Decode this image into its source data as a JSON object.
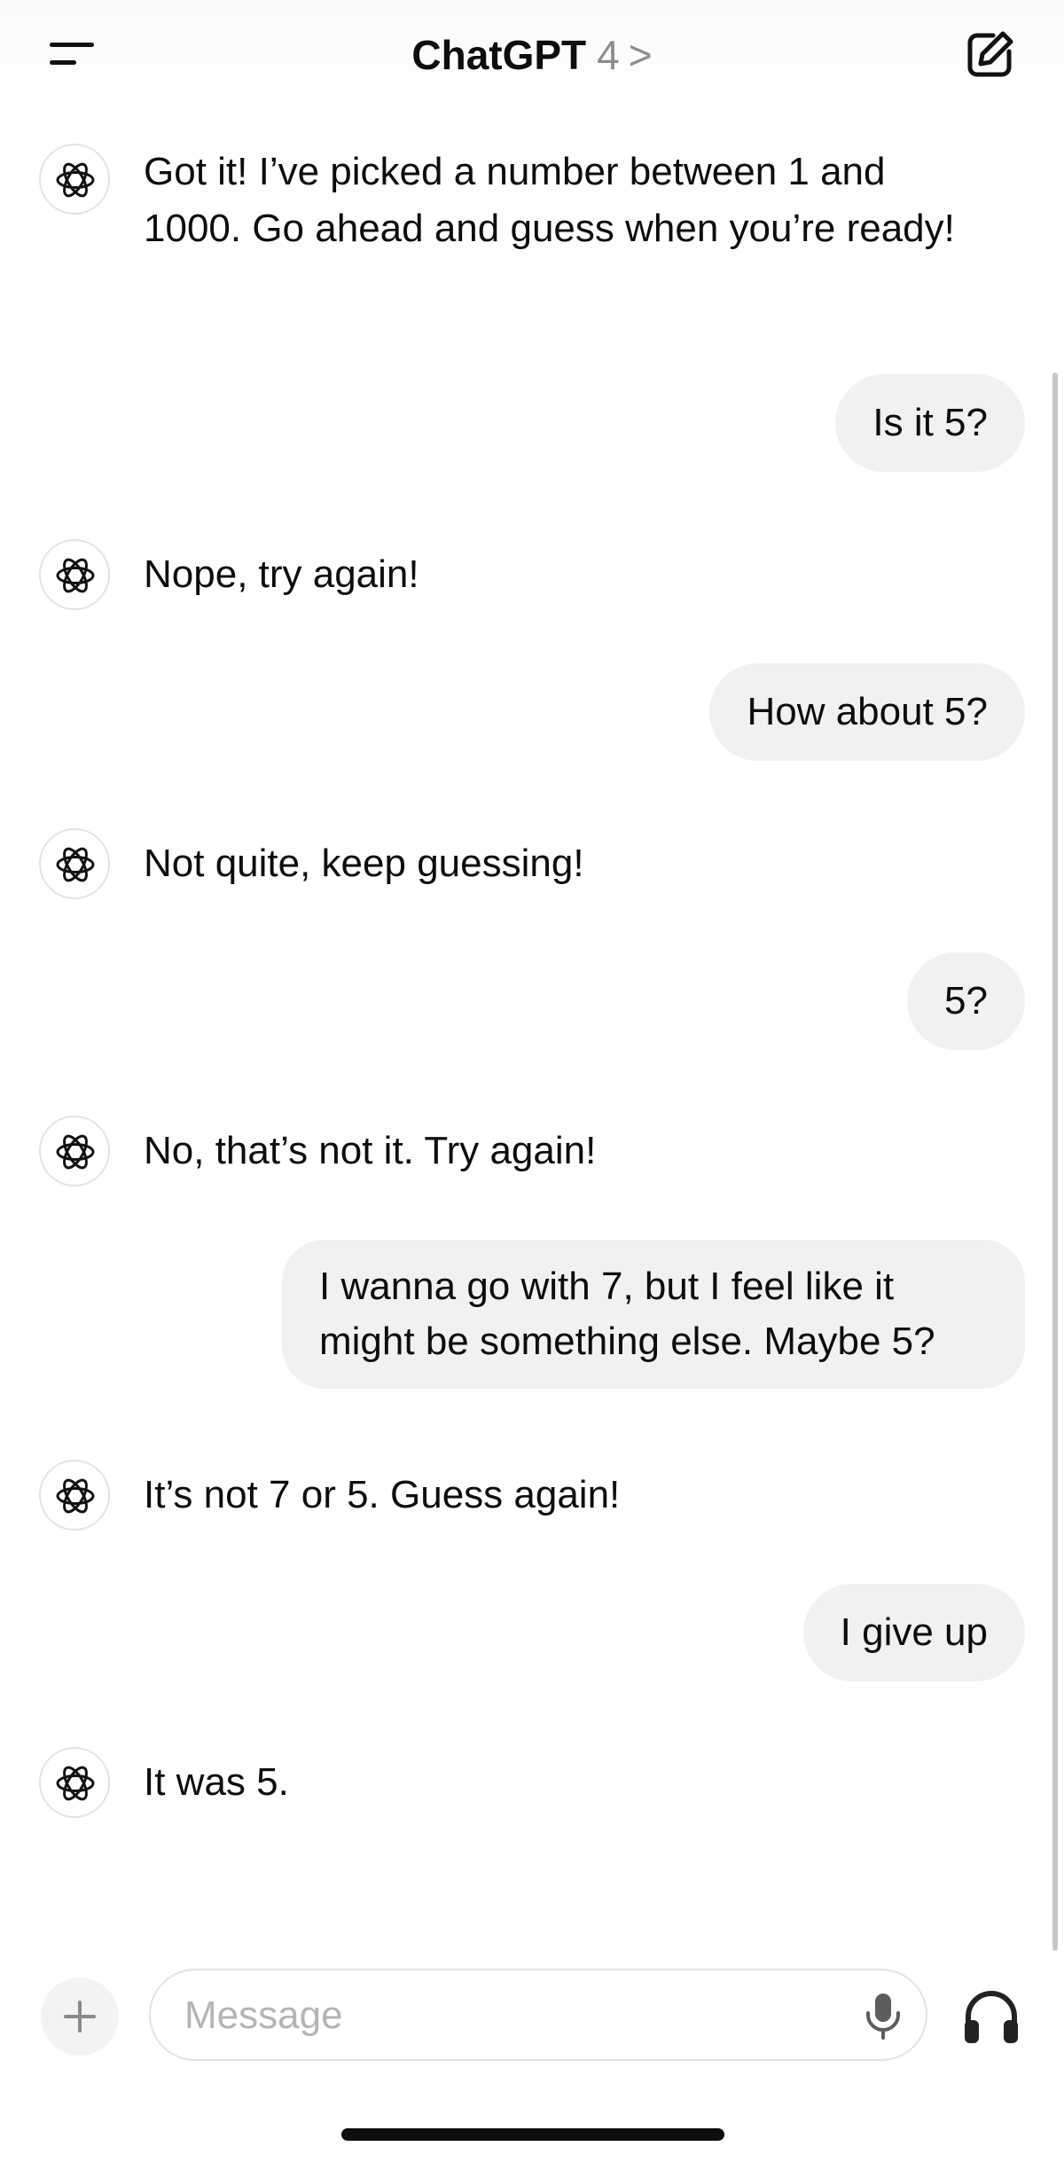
{
  "header": {
    "title": "ChatGPT",
    "model": "4",
    "chevron": ">",
    "icons": {
      "menu": "hamburger-menu-icon",
      "compose": "new-chat-compose-icon"
    }
  },
  "messages": [
    {
      "role": "assistant",
      "text": "Got it! I’ve picked a number between 1 and 1000. Go ahead and guess when you’re ready!"
    },
    {
      "role": "user",
      "text": "Is it 5?"
    },
    {
      "role": "assistant",
      "text": "Nope, try again!"
    },
    {
      "role": "user",
      "text": "How about 5?"
    },
    {
      "role": "assistant",
      "text": "Not quite, keep guessing!"
    },
    {
      "role": "user",
      "text": "5?"
    },
    {
      "role": "assistant",
      "text": "No, that’s not it. Try again!"
    },
    {
      "role": "user",
      "text": "I wanna go with 7, but I feel like it might be something else. Maybe 5?"
    },
    {
      "role": "assistant",
      "text": "It’s not 7 or 5. Guess again!"
    },
    {
      "role": "user",
      "text": "I give up"
    },
    {
      "role": "assistant",
      "text": "It was 5."
    }
  ],
  "composer": {
    "placeholder": "Message",
    "value": "",
    "icons": {
      "attach": "plus-icon",
      "mic": "microphone-icon",
      "voice": "headphones-icon"
    }
  },
  "colors": {
    "bubble": "#f1f1f1",
    "text": "#0d0d0d",
    "muted": "#8e8e8e",
    "placeholder": "#b4b4b4"
  }
}
